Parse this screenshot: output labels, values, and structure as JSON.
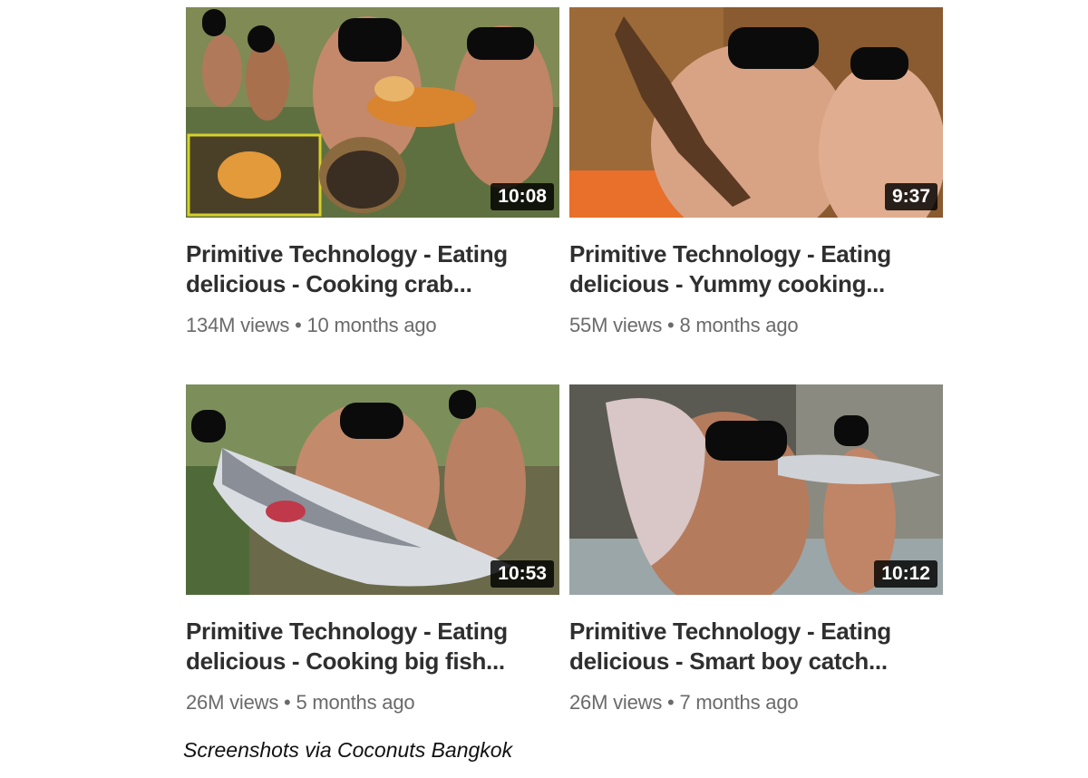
{
  "videos": [
    {
      "duration": "10:08",
      "title_line1": "Primitive Technology - Eating",
      "title_line2": "delicious - Cooking crab...",
      "views": "134M views",
      "age": "10 months ago"
    },
    {
      "duration": "9:37",
      "title_line1": "Primitive Technology - Eating",
      "title_line2": "delicious - Yummy cooking...",
      "views": "55M views",
      "age": "8 months ago"
    },
    {
      "duration": "10:53",
      "title_line1": "Primitive Technology - Eating",
      "title_line2": "delicious - Cooking big fish...",
      "views": "26M views",
      "age": "5 months ago"
    },
    {
      "duration": "10:12",
      "title_line1": "Primitive Technology - Eating",
      "title_line2": "delicious - Smart boy catch...",
      "views": "26M views",
      "age": "7 months ago"
    }
  ],
  "separator": "•",
  "caption": "Screenshots via Coconuts Bangkok"
}
